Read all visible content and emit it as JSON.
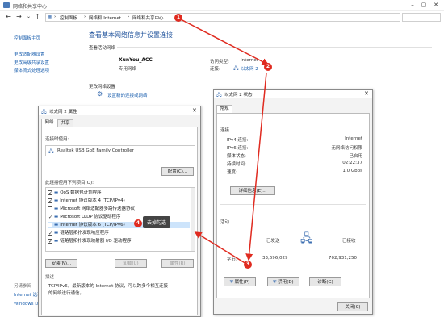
{
  "window": {
    "title": "网络和共享中心"
  },
  "address": {
    "crumbs": [
      "控制面板",
      "网络和 Internet",
      "网络和共享中心"
    ],
    "sep": "›"
  },
  "left_nav": {
    "home": "控制面板主页",
    "links": [
      "更改适配器设置",
      "更改高级共享设置",
      "媒体流式处理选项"
    ],
    "see_also": "另请参阅",
    "see_also_items": [
      "Internet 选项",
      "Windows Defender 防火墙"
    ]
  },
  "main": {
    "heading": "查看基本网络信息并设置连接",
    "active_label": "查看活动网络",
    "network_name": "XunYou_ACC",
    "network_type": "专用网络",
    "access_type_label": "访问类型:",
    "access_type": "Internet",
    "connection_label": "连接:",
    "connection": "以太网 2",
    "change_label": "更改网络设置",
    "setup_link": "设置新的连接或网络"
  },
  "props_dialog": {
    "title": "以太网 2 属性",
    "tabs": [
      "网络",
      "共享"
    ],
    "connect_using": "连接时使用:",
    "adapter": "Realtek USB GbE Family Controller",
    "config_button": "配置(C)...",
    "uses_items_label": "此连接使用下列项目(O):",
    "items": [
      {
        "label": "QoS 数据包计划程序",
        "checked": true
      },
      {
        "label": "Internet 协议版本 4 (TCP/IPv4)",
        "checked": true
      },
      {
        "label": "Microsoft 网络适配器多路传送器协议",
        "checked": false
      },
      {
        "label": "Microsoft LLDP 协议驱动程序",
        "checked": true
      },
      {
        "label": "Internet 协议版本 6 (TCP/IPv6)",
        "checked": false
      },
      {
        "label": "链路层拓扑发现响应程序",
        "checked": true
      },
      {
        "label": "链路层拓扑发现映射器 I/O 驱动程序",
        "checked": true
      }
    ],
    "install_button": "安装(N)...",
    "uninstall_button": "卸载(U)",
    "properties_button": "属性(R)",
    "desc_label": "描述",
    "description": "TCP/IPv6。最新版本的 Internet 协议，可以跨多个相互连接的网络进行通信。"
  },
  "status_dialog": {
    "title": "以太网 2 状态",
    "tab": "常规",
    "connection_label": "连接",
    "rows": [
      {
        "k": "IPv4 连接:",
        "v": "Internet"
      },
      {
        "k": "IPv6 连接:",
        "v": "无网络访问权限"
      },
      {
        "k": "媒体状态:",
        "v": "已启用"
      },
      {
        "k": "持续时间:",
        "v": "02:22:37"
      },
      {
        "k": "速度:",
        "v": "1.0 Gbps"
      }
    ],
    "details_button": "详细信息(E)...",
    "activity_label": "活动",
    "sent_label": "已发送",
    "received_label": "已接收",
    "bytes_label": "字节:",
    "bytes_sent": "33,696,029",
    "bytes_received": "702,931,250",
    "properties_button": "属性(P)",
    "disable_button": "禁用(D)",
    "diagnose_button": "诊断(G)",
    "close_button": "关闭(C)"
  },
  "annotations": {
    "badges": [
      "1",
      "2",
      "3",
      "4"
    ],
    "callout": "去掉勾选",
    "color": "#e02b20"
  }
}
